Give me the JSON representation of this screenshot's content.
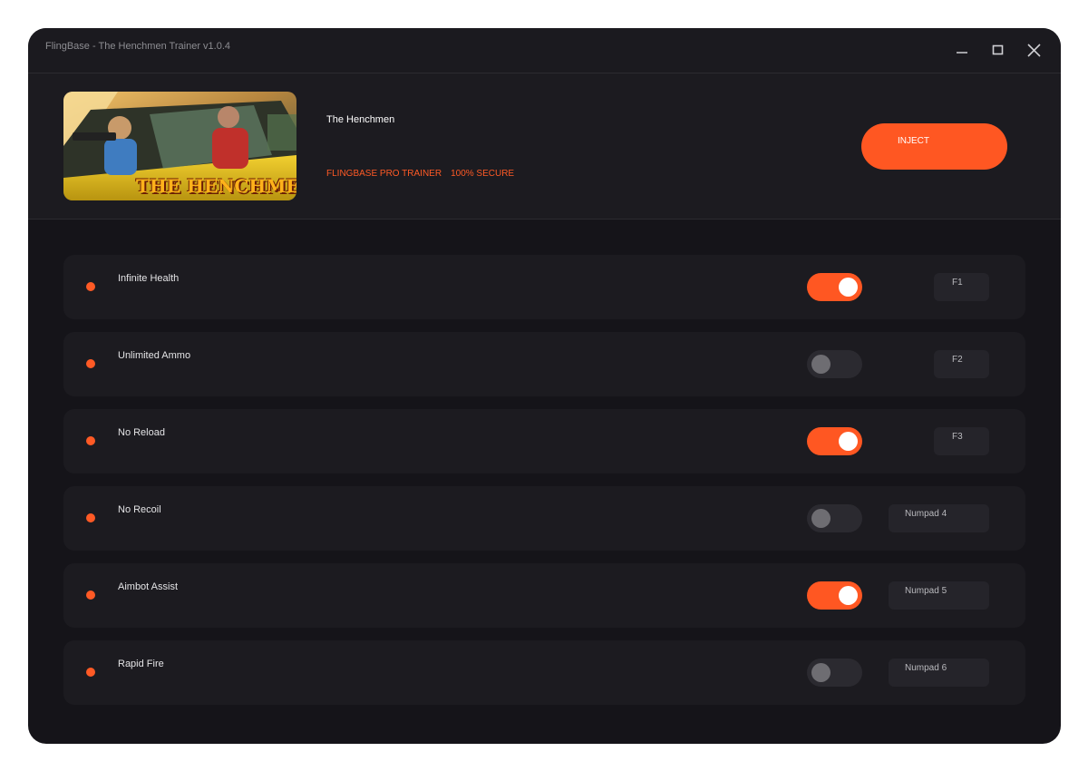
{
  "window": {
    "title": "FlingBase - The Henchmen Trainer v1.0.4"
  },
  "header": {
    "game_title": "The Henchmen",
    "tagline": "FLINGBASE PRO TRAINER 100% SECURE",
    "inject_label": "INJECT",
    "cover_art_text": "THE HENCHMEN"
  },
  "colors": {
    "accent": "#ff5722",
    "background": "#151419",
    "panel": "#1c1b20"
  },
  "icons": {
    "minimize": "minimize-icon",
    "maximize": "maximize-icon",
    "close": "close-icon",
    "status_dot": "status-dot-icon"
  },
  "cheats": [
    {
      "name": "Infinite Health",
      "enabled": true,
      "hotkey": "F1"
    },
    {
      "name": "Unlimited Ammo",
      "enabled": false,
      "hotkey": "F2"
    },
    {
      "name": "No Reload",
      "enabled": true,
      "hotkey": "F3"
    },
    {
      "name": "No Recoil",
      "enabled": false,
      "hotkey": "Numpad 4"
    },
    {
      "name": "Aimbot Assist",
      "enabled": true,
      "hotkey": "Numpad 5"
    },
    {
      "name": "Rapid Fire",
      "enabled": false,
      "hotkey": "Numpad 6"
    }
  ]
}
